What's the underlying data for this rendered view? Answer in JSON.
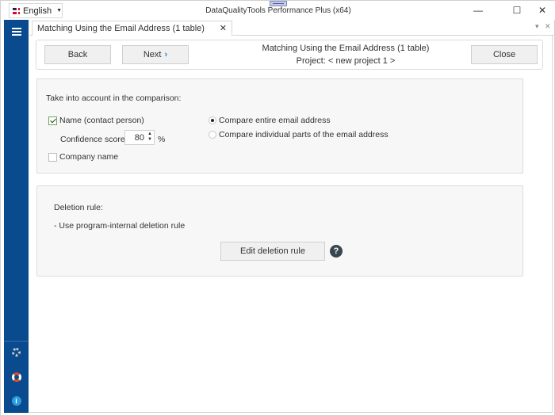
{
  "window": {
    "title": "DataQualityTools Performance Plus (x64)",
    "language": "English",
    "controls": {
      "minimize": "—",
      "maximize": "☐",
      "close": "✕"
    }
  },
  "sidebar": {
    "menu_icon": "hamburger-icon",
    "bottom_icons": [
      "gear-icon",
      "lifebuoy-icon",
      "info-icon"
    ]
  },
  "tabs": [
    {
      "label": "Matching Using the Email Address (1 table)",
      "close": "✕",
      "active": true
    }
  ],
  "tabstrip_controls": {
    "dropdown": "▾",
    "close": "✕"
  },
  "toolbar": {
    "back_label": "Back",
    "next_label": "Next",
    "next_chevron": "›",
    "title": "Matching Using the Email Address (1 table)",
    "project": "Project: < new project 1 >",
    "close_label": "Close"
  },
  "comparison": {
    "heading": "Take into account in the comparison:",
    "name_checkbox": {
      "label": "Name (contact person)",
      "checked": true
    },
    "confidence": {
      "label": "Confidence score",
      "value": "80",
      "unit": "%"
    },
    "company_checkbox": {
      "label": "Company name",
      "checked": false
    },
    "radios": [
      {
        "label": "Compare entire email address",
        "selected": true
      },
      {
        "label": "Compare individual parts of the email address",
        "selected": false
      }
    ]
  },
  "deletion": {
    "heading": "Deletion rule:",
    "rule": "- Use program-internal deletion rule",
    "edit_label": "Edit deletion rule",
    "help": "?"
  },
  "colors": {
    "sidebar": "#0a4a8e",
    "accent": "#1e88e5",
    "checkbox_border": "#6aa84f"
  }
}
